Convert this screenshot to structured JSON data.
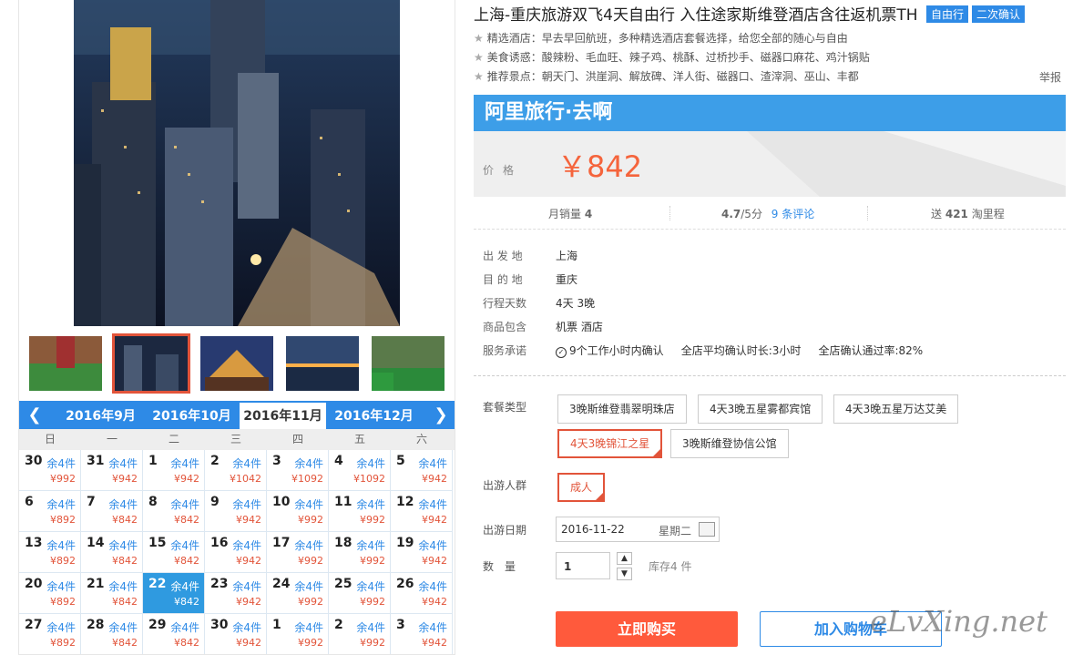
{
  "title": "上海-重庆旅游双飞4天自由行 入住途家斯维登酒店含往返机票TH",
  "tags": [
    "自由行",
    "二次确认"
  ],
  "features": [
    "精选酒店：早去早回航班，多种精选酒店套餐选择，给您全部的随心与自由",
    "美食诱惑：酸辣粉、毛血旺、辣子鸡、桃酥、过桥抄手、磁器口麻花、鸡汁锅贴",
    "推荐景点：朝天门、洪崖洞、解放碑、洋人街、磁器口、渣滓洞、巫山、丰都"
  ],
  "report": "举报",
  "brand": "阿里旅行·去啊",
  "price_label": "价格",
  "price": "￥842",
  "stats": {
    "sales_label": "月销量",
    "sales": "4",
    "rating": "4.7",
    "rating_suffix": "/5分",
    "reviews": "9 条评论",
    "reward_prefix": "送",
    "reward": "421",
    "reward_suffix": "淘里程"
  },
  "info": [
    {
      "k": "出 发 地",
      "v": "上海"
    },
    {
      "k": "目 的 地",
      "v": "重庆"
    },
    {
      "k": "行程天数",
      "v": "4天 3晚"
    },
    {
      "k": "商品包含",
      "v": "机票  酒店"
    },
    {
      "k": "服务承诺",
      "v": "9个工作小时内确认     全店平均确认时长:3小时     全店确认通过率:82%"
    }
  ],
  "package_label": "套餐类型",
  "packages": [
    "3晚斯维登翡翠明珠店",
    "4天3晚五星雾都宾馆",
    "4天3晚五星万达艾美",
    "4天3晚锦江之星",
    "3晚斯维登协信公馆"
  ],
  "selected_package": 3,
  "crowd_label": "出游人群",
  "crowd": "成人",
  "date_label": "出游日期",
  "date": "2016-11-22",
  "weekday": "星期二",
  "qty_label": "数　量",
  "qty": "1",
  "stock": "库存4 件",
  "buy": "立即购买",
  "cart": "加入购物车",
  "watermark": "eLvXing.net",
  "calendar": {
    "months": [
      "2016年9月",
      "2016年10月",
      "2016年11月",
      "2016年12月"
    ],
    "active_month": 2,
    "weekdays": [
      "日",
      "一",
      "二",
      "三",
      "四",
      "五",
      "六"
    ],
    "weeks": [
      [
        {
          "d": "30",
          "s": "余4件",
          "p": "¥992"
        },
        {
          "d": "31",
          "s": "余4件",
          "p": "¥942"
        },
        {
          "d": "1",
          "s": "余4件",
          "p": "¥942"
        },
        {
          "d": "2",
          "s": "余4件",
          "p": "¥1042"
        },
        {
          "d": "3",
          "s": "余4件",
          "p": "¥1092"
        },
        {
          "d": "4",
          "s": "余4件",
          "p": "¥1092"
        },
        {
          "d": "5",
          "s": "余4件",
          "p": "¥942"
        }
      ],
      [
        {
          "d": "6",
          "s": "余4件",
          "p": "¥892"
        },
        {
          "d": "7",
          "s": "余4件",
          "p": "¥842"
        },
        {
          "d": "8",
          "s": "余4件",
          "p": "¥842"
        },
        {
          "d": "9",
          "s": "余4件",
          "p": "¥942"
        },
        {
          "d": "10",
          "s": "余4件",
          "p": "¥992"
        },
        {
          "d": "11",
          "s": "余4件",
          "p": "¥992"
        },
        {
          "d": "12",
          "s": "余4件",
          "p": "¥942"
        }
      ],
      [
        {
          "d": "13",
          "s": "余4件",
          "p": "¥892"
        },
        {
          "d": "14",
          "s": "余4件",
          "p": "¥842"
        },
        {
          "d": "15",
          "s": "余4件",
          "p": "¥842"
        },
        {
          "d": "16",
          "s": "余4件",
          "p": "¥942"
        },
        {
          "d": "17",
          "s": "余4件",
          "p": "¥992"
        },
        {
          "d": "18",
          "s": "余4件",
          "p": "¥992"
        },
        {
          "d": "19",
          "s": "余4件",
          "p": "¥942"
        }
      ],
      [
        {
          "d": "20",
          "s": "余4件",
          "p": "¥892"
        },
        {
          "d": "21",
          "s": "余4件",
          "p": "¥842"
        },
        {
          "d": "22",
          "s": "余4件",
          "p": "¥842"
        },
        {
          "d": "23",
          "s": "余4件",
          "p": "¥942"
        },
        {
          "d": "24",
          "s": "余4件",
          "p": "¥992"
        },
        {
          "d": "25",
          "s": "余4件",
          "p": "¥992"
        },
        {
          "d": "26",
          "s": "余4件",
          "p": "¥942"
        }
      ],
      [
        {
          "d": "27",
          "s": "余4件",
          "p": "¥892"
        },
        {
          "d": "28",
          "s": "余4件",
          "p": "¥842"
        },
        {
          "d": "29",
          "s": "余4件",
          "p": "¥842"
        },
        {
          "d": "30",
          "s": "余4件",
          "p": "¥942"
        },
        {
          "d": "1",
          "s": "余4件",
          "p": "¥992"
        },
        {
          "d": "2",
          "s": "余4件",
          "p": "¥992"
        },
        {
          "d": "3",
          "s": "余4件",
          "p": "¥942"
        }
      ]
    ],
    "selected_day": "22"
  },
  "colors": {
    "accent": "#2e8ae6",
    "price": "#f5643c",
    "selected": "#e2543a"
  }
}
